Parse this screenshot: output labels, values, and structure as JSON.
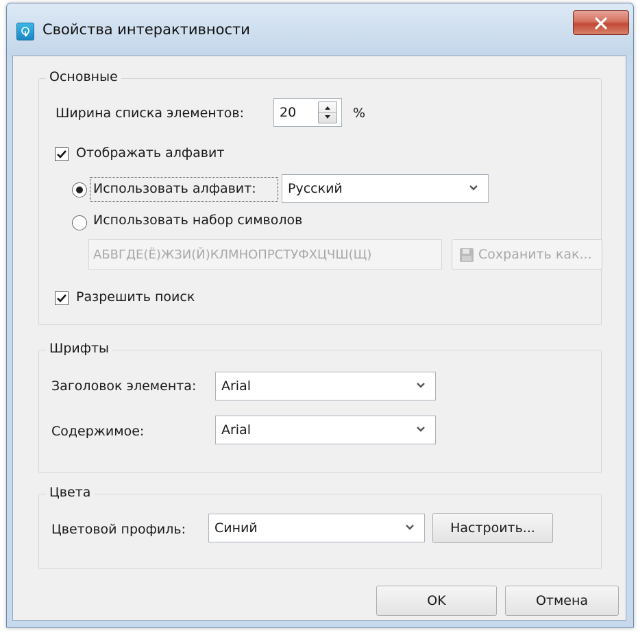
{
  "window": {
    "title": "Свойства интерактивности"
  },
  "groups": {
    "basic": {
      "legend": "Основные",
      "list_width_label": "Ширина списка элементов:",
      "list_width_value": "20",
      "list_width_unit": "%",
      "show_alphabet_label": "Отображать алфавит",
      "show_alphabet_checked": true,
      "use_alphabet_label": "Использовать алфавит:",
      "use_alphabet_value": "Русский",
      "use_charset_label": "Использовать набор символов",
      "charset_value": "АБВГДЕ(Ё)ЖЗИ(Й)КЛМНОПРСТУФХЦЧШ(Щ)",
      "save_as_label": "Сохранить как...",
      "allow_search_label": "Разрешить поиск",
      "allow_search_checked": true
    },
    "fonts": {
      "legend": "Шрифты",
      "heading_label": "Заголовок элемента:",
      "heading_value": "Arial",
      "content_label": "Содержимое:",
      "content_value": "Arial"
    },
    "colors": {
      "legend": "Цвета",
      "profile_label": "Цветовой профиль:",
      "profile_value": "Синий",
      "configure_label": "Настроить..."
    }
  },
  "footer": {
    "ok_label": "OK",
    "cancel_label": "Отмена"
  },
  "icons": {
    "app": "touch-app-icon",
    "close": "close-icon",
    "save": "floppy-disk-icon",
    "dropdown": "chevron-down-icon"
  }
}
